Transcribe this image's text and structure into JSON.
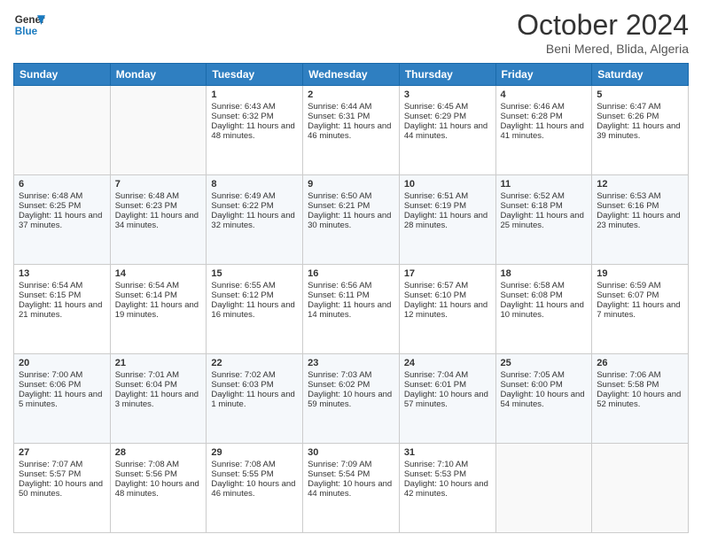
{
  "header": {
    "logo_line1": "General",
    "logo_line2": "Blue",
    "month": "October 2024",
    "location": "Beni Mered, Blida, Algeria"
  },
  "weekdays": [
    "Sunday",
    "Monday",
    "Tuesday",
    "Wednesday",
    "Thursday",
    "Friday",
    "Saturday"
  ],
  "weeks": [
    [
      {
        "day": "",
        "sunrise": "",
        "sunset": "",
        "daylight": ""
      },
      {
        "day": "",
        "sunrise": "",
        "sunset": "",
        "daylight": ""
      },
      {
        "day": "1",
        "sunrise": "Sunrise: 6:43 AM",
        "sunset": "Sunset: 6:32 PM",
        "daylight": "Daylight: 11 hours and 48 minutes."
      },
      {
        "day": "2",
        "sunrise": "Sunrise: 6:44 AM",
        "sunset": "Sunset: 6:31 PM",
        "daylight": "Daylight: 11 hours and 46 minutes."
      },
      {
        "day": "3",
        "sunrise": "Sunrise: 6:45 AM",
        "sunset": "Sunset: 6:29 PM",
        "daylight": "Daylight: 11 hours and 44 minutes."
      },
      {
        "day": "4",
        "sunrise": "Sunrise: 6:46 AM",
        "sunset": "Sunset: 6:28 PM",
        "daylight": "Daylight: 11 hours and 41 minutes."
      },
      {
        "day": "5",
        "sunrise": "Sunrise: 6:47 AM",
        "sunset": "Sunset: 6:26 PM",
        "daylight": "Daylight: 11 hours and 39 minutes."
      }
    ],
    [
      {
        "day": "6",
        "sunrise": "Sunrise: 6:48 AM",
        "sunset": "Sunset: 6:25 PM",
        "daylight": "Daylight: 11 hours and 37 minutes."
      },
      {
        "day": "7",
        "sunrise": "Sunrise: 6:48 AM",
        "sunset": "Sunset: 6:23 PM",
        "daylight": "Daylight: 11 hours and 34 minutes."
      },
      {
        "day": "8",
        "sunrise": "Sunrise: 6:49 AM",
        "sunset": "Sunset: 6:22 PM",
        "daylight": "Daylight: 11 hours and 32 minutes."
      },
      {
        "day": "9",
        "sunrise": "Sunrise: 6:50 AM",
        "sunset": "Sunset: 6:21 PM",
        "daylight": "Daylight: 11 hours and 30 minutes."
      },
      {
        "day": "10",
        "sunrise": "Sunrise: 6:51 AM",
        "sunset": "Sunset: 6:19 PM",
        "daylight": "Daylight: 11 hours and 28 minutes."
      },
      {
        "day": "11",
        "sunrise": "Sunrise: 6:52 AM",
        "sunset": "Sunset: 6:18 PM",
        "daylight": "Daylight: 11 hours and 25 minutes."
      },
      {
        "day": "12",
        "sunrise": "Sunrise: 6:53 AM",
        "sunset": "Sunset: 6:16 PM",
        "daylight": "Daylight: 11 hours and 23 minutes."
      }
    ],
    [
      {
        "day": "13",
        "sunrise": "Sunrise: 6:54 AM",
        "sunset": "Sunset: 6:15 PM",
        "daylight": "Daylight: 11 hours and 21 minutes."
      },
      {
        "day": "14",
        "sunrise": "Sunrise: 6:54 AM",
        "sunset": "Sunset: 6:14 PM",
        "daylight": "Daylight: 11 hours and 19 minutes."
      },
      {
        "day": "15",
        "sunrise": "Sunrise: 6:55 AM",
        "sunset": "Sunset: 6:12 PM",
        "daylight": "Daylight: 11 hours and 16 minutes."
      },
      {
        "day": "16",
        "sunrise": "Sunrise: 6:56 AM",
        "sunset": "Sunset: 6:11 PM",
        "daylight": "Daylight: 11 hours and 14 minutes."
      },
      {
        "day": "17",
        "sunrise": "Sunrise: 6:57 AM",
        "sunset": "Sunset: 6:10 PM",
        "daylight": "Daylight: 11 hours and 12 minutes."
      },
      {
        "day": "18",
        "sunrise": "Sunrise: 6:58 AM",
        "sunset": "Sunset: 6:08 PM",
        "daylight": "Daylight: 11 hours and 10 minutes."
      },
      {
        "day": "19",
        "sunrise": "Sunrise: 6:59 AM",
        "sunset": "Sunset: 6:07 PM",
        "daylight": "Daylight: 11 hours and 7 minutes."
      }
    ],
    [
      {
        "day": "20",
        "sunrise": "Sunrise: 7:00 AM",
        "sunset": "Sunset: 6:06 PM",
        "daylight": "Daylight: 11 hours and 5 minutes."
      },
      {
        "day": "21",
        "sunrise": "Sunrise: 7:01 AM",
        "sunset": "Sunset: 6:04 PM",
        "daylight": "Daylight: 11 hours and 3 minutes."
      },
      {
        "day": "22",
        "sunrise": "Sunrise: 7:02 AM",
        "sunset": "Sunset: 6:03 PM",
        "daylight": "Daylight: 11 hours and 1 minute."
      },
      {
        "day": "23",
        "sunrise": "Sunrise: 7:03 AM",
        "sunset": "Sunset: 6:02 PM",
        "daylight": "Daylight: 10 hours and 59 minutes."
      },
      {
        "day": "24",
        "sunrise": "Sunrise: 7:04 AM",
        "sunset": "Sunset: 6:01 PM",
        "daylight": "Daylight: 10 hours and 57 minutes."
      },
      {
        "day": "25",
        "sunrise": "Sunrise: 7:05 AM",
        "sunset": "Sunset: 6:00 PM",
        "daylight": "Daylight: 10 hours and 54 minutes."
      },
      {
        "day": "26",
        "sunrise": "Sunrise: 7:06 AM",
        "sunset": "Sunset: 5:58 PM",
        "daylight": "Daylight: 10 hours and 52 minutes."
      }
    ],
    [
      {
        "day": "27",
        "sunrise": "Sunrise: 7:07 AM",
        "sunset": "Sunset: 5:57 PM",
        "daylight": "Daylight: 10 hours and 50 minutes."
      },
      {
        "day": "28",
        "sunrise": "Sunrise: 7:08 AM",
        "sunset": "Sunset: 5:56 PM",
        "daylight": "Daylight: 10 hours and 48 minutes."
      },
      {
        "day": "29",
        "sunrise": "Sunrise: 7:08 AM",
        "sunset": "Sunset: 5:55 PM",
        "daylight": "Daylight: 10 hours and 46 minutes."
      },
      {
        "day": "30",
        "sunrise": "Sunrise: 7:09 AM",
        "sunset": "Sunset: 5:54 PM",
        "daylight": "Daylight: 10 hours and 44 minutes."
      },
      {
        "day": "31",
        "sunrise": "Sunrise: 7:10 AM",
        "sunset": "Sunset: 5:53 PM",
        "daylight": "Daylight: 10 hours and 42 minutes."
      },
      {
        "day": "",
        "sunrise": "",
        "sunset": "",
        "daylight": ""
      },
      {
        "day": "",
        "sunrise": "",
        "sunset": "",
        "daylight": ""
      }
    ]
  ]
}
